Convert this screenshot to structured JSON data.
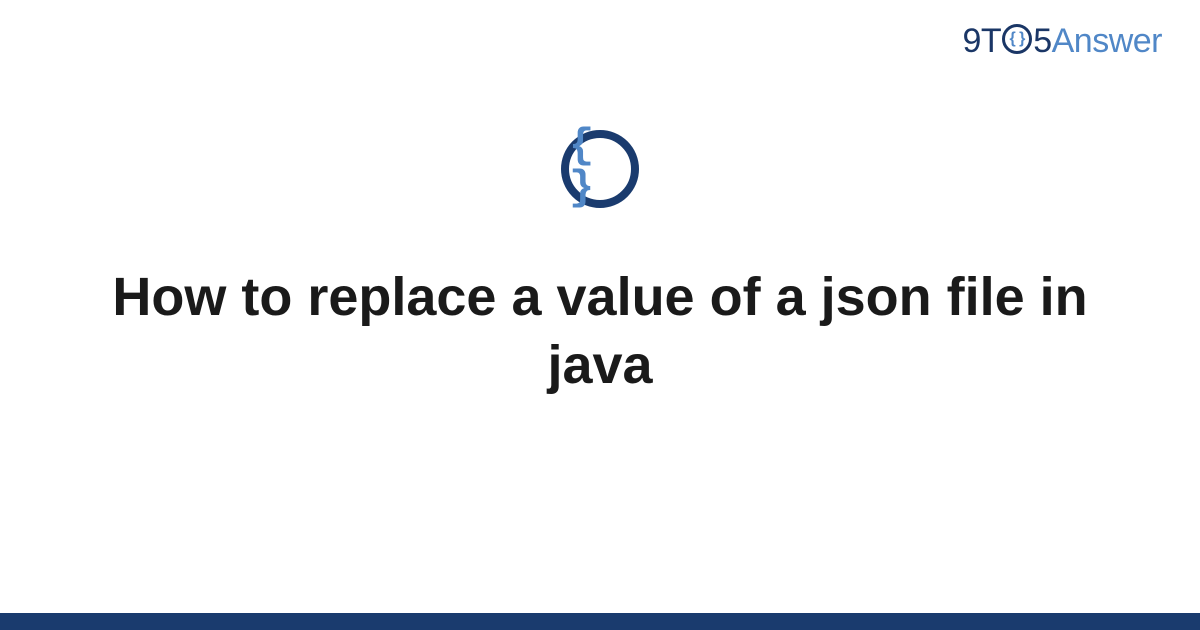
{
  "brand": {
    "part_9t": "9T",
    "clock_glyph": "{ }",
    "part_5": "5",
    "part_answer": "Answer"
  },
  "center_icon": {
    "glyph": "{ }",
    "semantic": "json-braces-icon"
  },
  "title": "How to replace a value of a json file in java",
  "colors": {
    "brand_dark": "#1a3666",
    "brand_light": "#5087c7",
    "footer": "#1a3b6e",
    "text": "#1a1a1a"
  }
}
